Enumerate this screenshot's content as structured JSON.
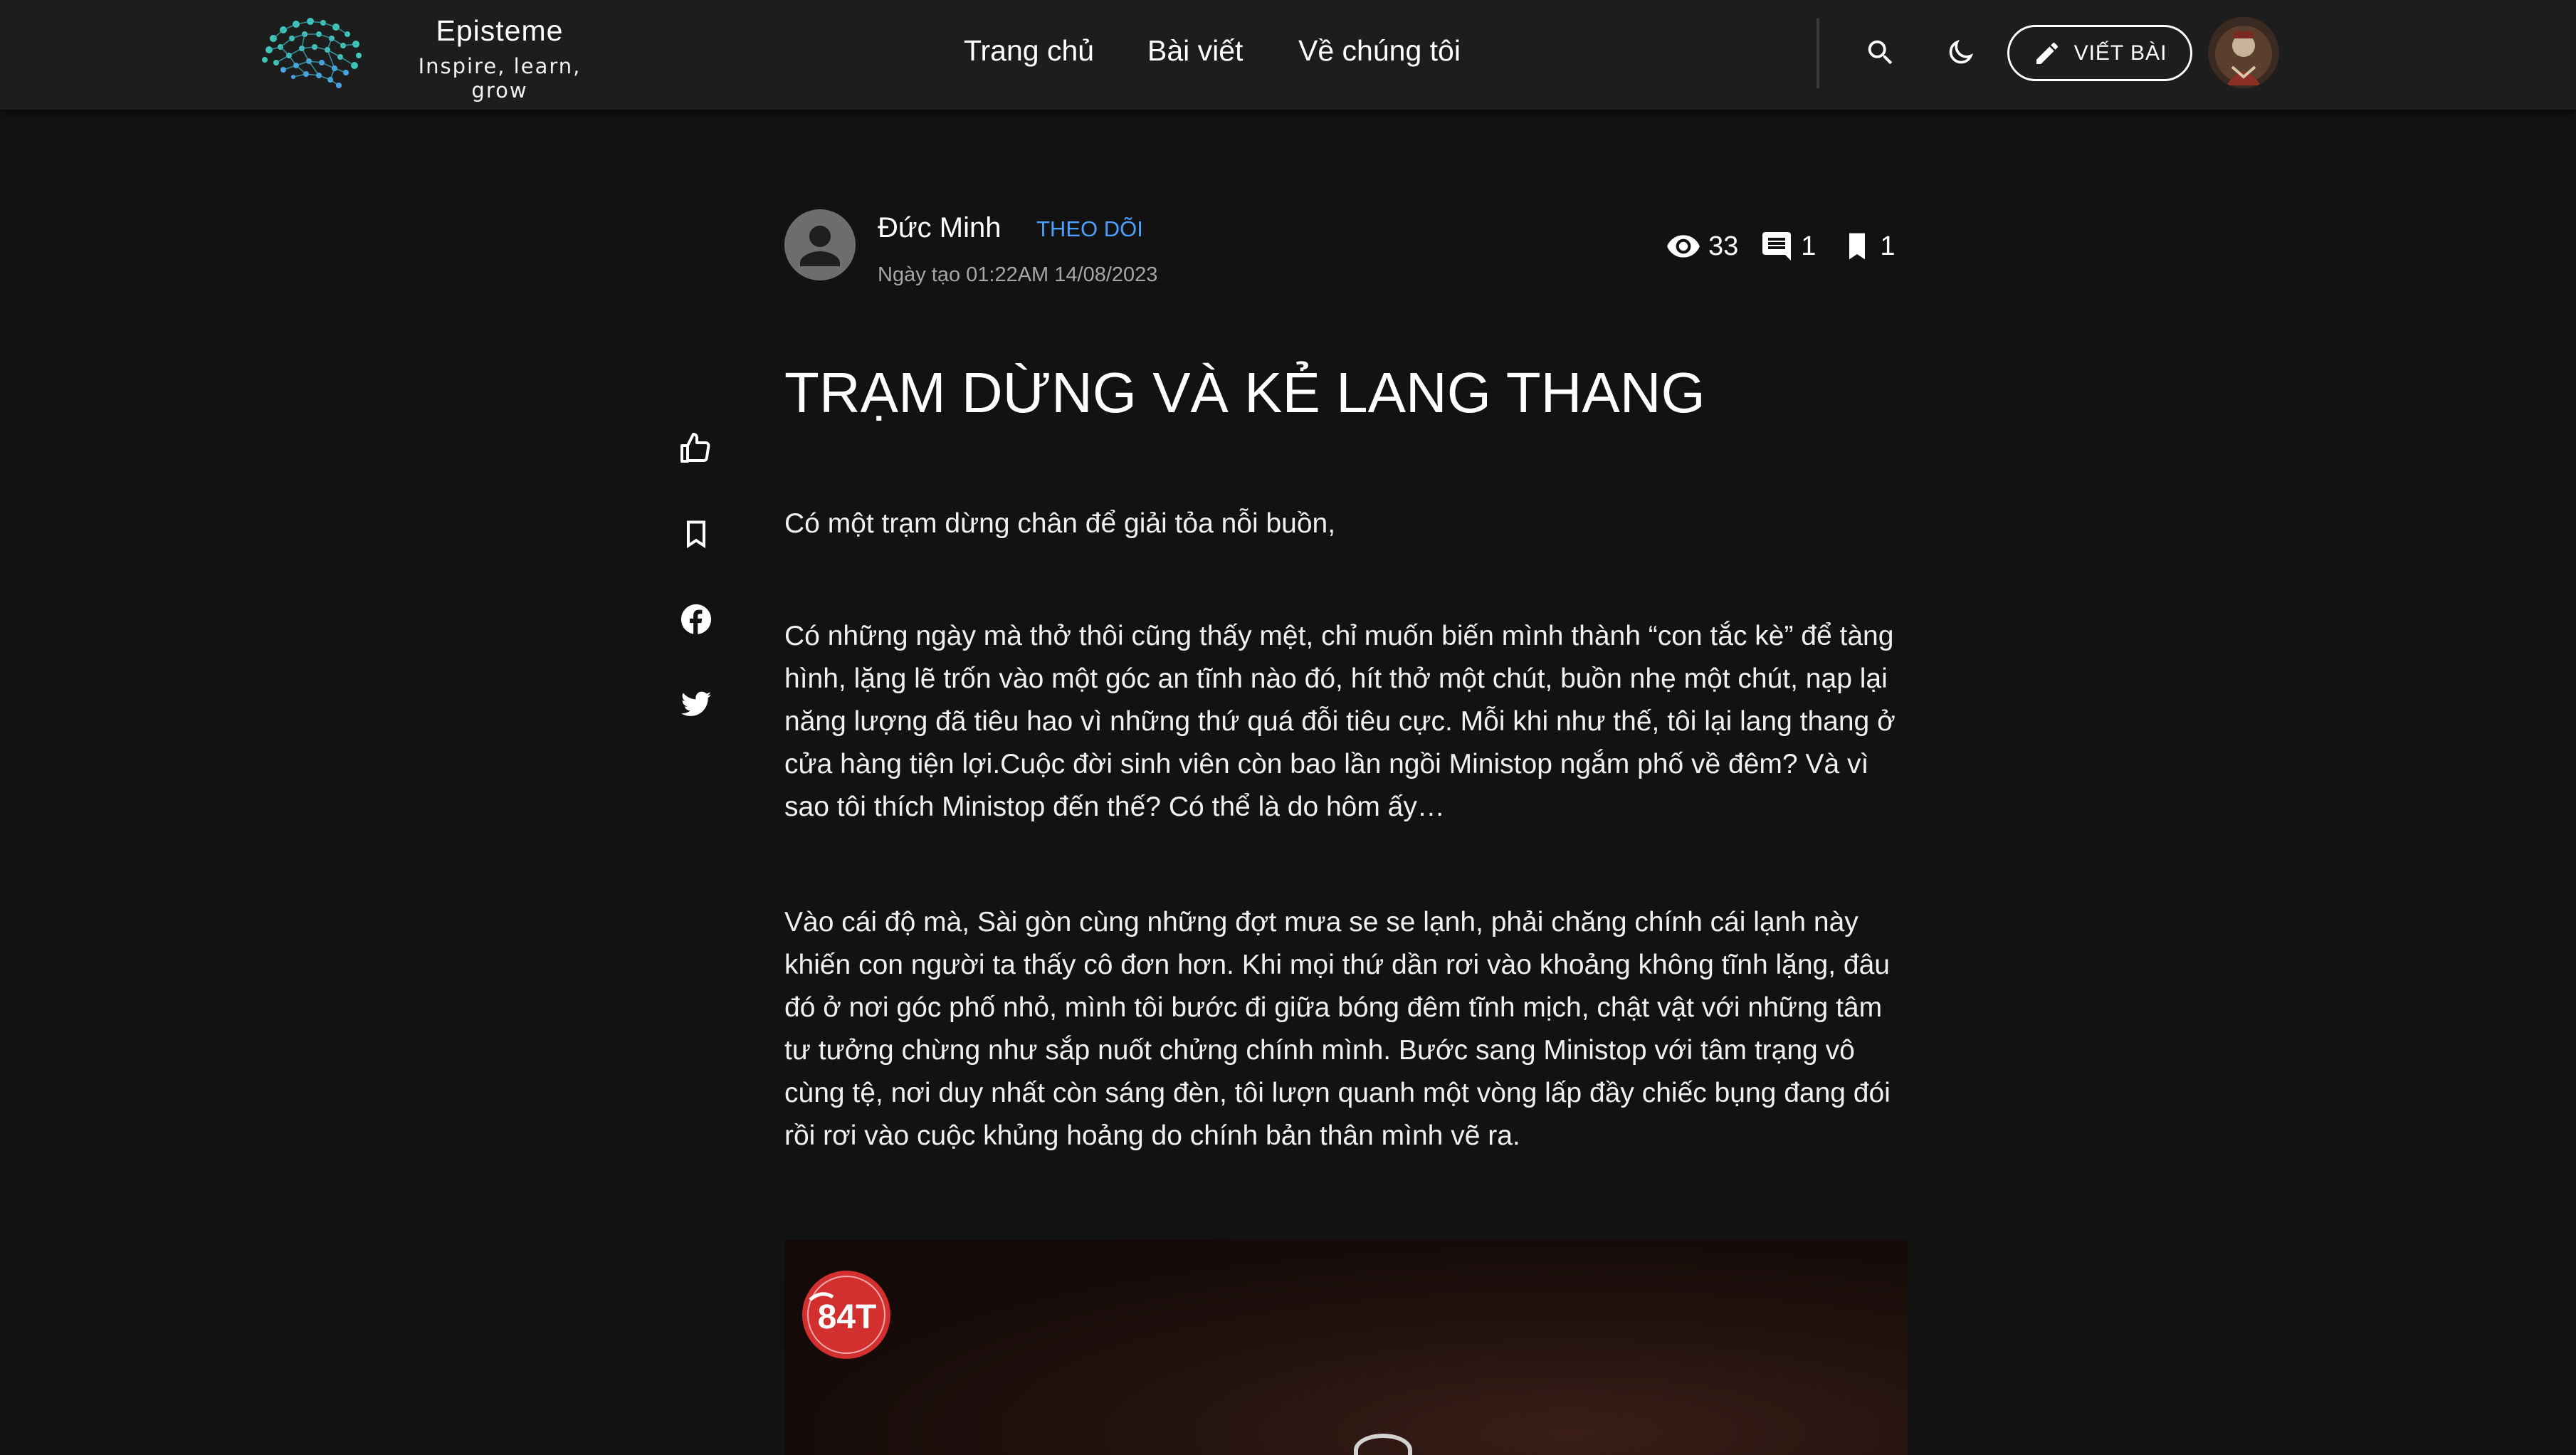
{
  "header": {
    "brand_name": "Episteme",
    "brand_tagline": "Inspire, learn, grow",
    "nav": [
      {
        "label": "Trang chủ"
      },
      {
        "label": "Bài viết"
      },
      {
        "label": "Về chúng tôi"
      }
    ],
    "write_button_label": "VIẾT BÀI",
    "icons": {
      "search": "search-icon",
      "theme": "moon-icon",
      "write": "pencil-icon",
      "avatar": "user-avatar"
    }
  },
  "rail": {
    "icons": [
      "thumbs-up-icon",
      "bookmark-icon",
      "facebook-icon",
      "twitter-icon"
    ]
  },
  "post": {
    "author_name": "Đức Minh",
    "follow_label": "THEO DÕI",
    "created_at": "Ngày tạo 01:22AM 14/08/2023",
    "stats": {
      "views": "33",
      "comments": "1",
      "bookmarks": "1"
    },
    "title": "TRẠM DỪNG VÀ KẺ LANG THANG",
    "paragraphs": [
      "Có một trạm dừng chân để giải tỏa nỗi buồn,",
      "Có những ngày mà thở thôi cũng thấy mệt, chỉ muốn biến mình thành “con tắc kè” để tàng hình, lặng lẽ trốn vào một góc an tĩnh nào đó, hít thở một chút, buồn nhẹ một chút, nạp lại năng lượng đã tiêu hao vì những thứ quá đỗi tiêu cực. Mỗi khi như thế, tôi lại lang thang ở cửa hàng tiện lợi.Cuộc đời sinh viên còn bao lần ngồi Ministop ngắm phố về đêm? Và vì sao tôi thích Ministop đến thế? Có thể là do hôm ấy…",
      "Vào cái độ mà, Sài gòn cùng những đợt mưa se se lạnh, phải chăng chính cái lạnh này khiến con người ta thấy cô đơn hơn. Khi mọi thứ dần rơi vào khoảng không tĩnh lặng, đâu đó ở nơi góc phố nhỏ, mình tôi bước đi giữa bóng đêm tĩnh mịch, chật vật với những tâm tư tưởng chừng như sắp nuốt chửng chính mình. Bước sang Ministop với tâm trạng vô cùng tệ, nơi duy nhất còn sáng đèn, tôi lượn quanh một vòng lấp đầy chiếc bụng đang đói rồi rơi vào cuộc khủng hoảng do chính bản thân mình vẽ ra."
    ],
    "image_badge_text": "84T"
  },
  "colors": {
    "background": "#121212",
    "header": "#1d1d1d",
    "accent": "#4d9fff",
    "muted": "#a6a6a6"
  }
}
